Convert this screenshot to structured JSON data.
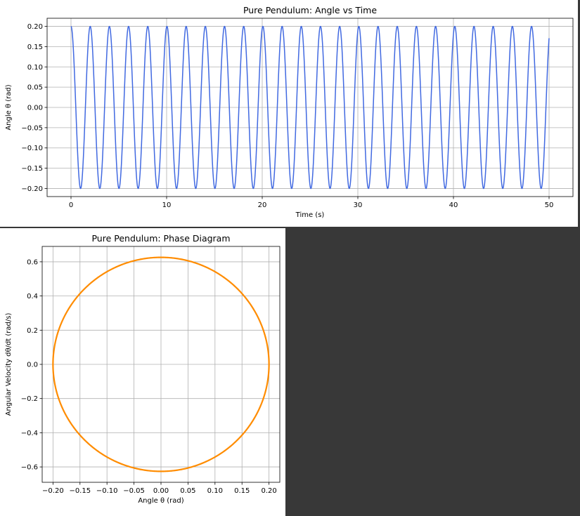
{
  "chart_data": [
    {
      "type": "line",
      "title": "Pure Pendulum: Angle vs Time",
      "xlabel": "Time (s)",
      "ylabel": "Angle θ (rad)",
      "xlim": [
        -2.5,
        52.5
      ],
      "ylim": [
        -0.22,
        0.22
      ],
      "xticks": [
        0,
        10,
        20,
        30,
        40,
        50
      ],
      "xtick_labels": [
        "0",
        "10",
        "20",
        "30",
        "40",
        "50"
      ],
      "yticks": [
        -0.2,
        -0.15,
        -0.1,
        -0.05,
        0.0,
        0.05,
        0.1,
        0.15,
        0.2
      ],
      "ytick_labels": [
        "−0.20",
        "−0.15",
        "−0.10",
        "−0.05",
        "0.00",
        "0.05",
        "0.10",
        "0.15",
        "0.20"
      ],
      "grid": true,
      "series": [
        {
          "color": "#4169e1",
          "function": "theta(t) = 0.20 * cos(2*pi*t/2.007)",
          "amplitude": 0.2,
          "period": 2.007,
          "t_range": [
            0,
            50
          ]
        }
      ]
    },
    {
      "type": "line",
      "title": "Pure Pendulum: Phase Diagram",
      "xlabel": "Angle θ (rad)",
      "ylabel": "Angular Velocity dθ/dt (rad/s)",
      "xlim": [
        -0.22,
        0.22
      ],
      "ylim": [
        -0.69,
        0.69
      ],
      "xticks": [
        -0.2,
        -0.15,
        -0.1,
        -0.05,
        0.0,
        0.05,
        0.1,
        0.15,
        0.2
      ],
      "xtick_labels": [
        "−0.20",
        "−0.15",
        "−0.10",
        "−0.05",
        "0.00",
        "0.05",
        "0.10",
        "0.15",
        "0.20"
      ],
      "yticks": [
        -0.6,
        -0.4,
        -0.2,
        0.0,
        0.2,
        0.4,
        0.6
      ],
      "ytick_labels": [
        "−0.6",
        "−0.4",
        "−0.2",
        "0.0",
        "0.2",
        "0.4",
        "0.6"
      ],
      "grid": true,
      "series": [
        {
          "color": "#ff8c00",
          "function": "ellipse: theta = 0.20*cos(s), omega = -0.626*sin(s)",
          "theta_amplitude": 0.2,
          "omega_amplitude": 0.626
        }
      ]
    }
  ]
}
